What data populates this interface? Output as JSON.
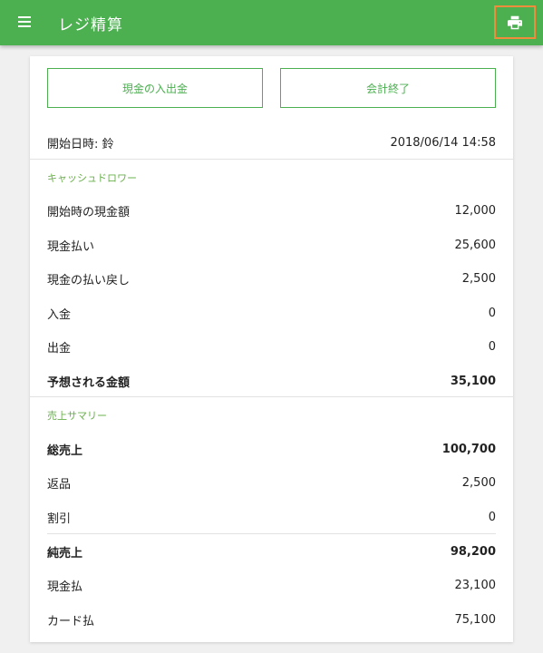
{
  "app": {
    "title": "レジ精算"
  },
  "icons": {
    "menu": "menu-icon",
    "print": "print-icon"
  },
  "colors": {
    "appbar": "#4caf50",
    "accent": "#4caf50",
    "highlight": "#f08c3c"
  },
  "actions": {
    "cash_in_out": "現金の入出金",
    "close_register": "会計終了"
  },
  "session": {
    "label": "開始日時: 鈴",
    "datetime": "2018/06/14 14:58"
  },
  "cash_drawer": {
    "heading": "キャッシュドロワー",
    "rows": [
      {
        "label": "開始時の現金額",
        "value": "12,000"
      },
      {
        "label": "現金払い",
        "value": "25,600"
      },
      {
        "label": "現金の払い戻し",
        "value": "2,500"
      },
      {
        "label": "入金",
        "value": "0"
      },
      {
        "label": "出金",
        "value": "0"
      },
      {
        "label": "予想される金額",
        "value": "35,100"
      }
    ]
  },
  "sales_summary": {
    "heading": "売上サマリー",
    "rows": [
      {
        "label": "総売上",
        "value": "100,700"
      },
      {
        "label": "返品",
        "value": "2,500"
      },
      {
        "label": "割引",
        "value": "0"
      },
      {
        "label": "純売上",
        "value": "98,200"
      },
      {
        "label": "現金払",
        "value": "23,100"
      },
      {
        "label": "カード払",
        "value": "75,100"
      }
    ]
  }
}
